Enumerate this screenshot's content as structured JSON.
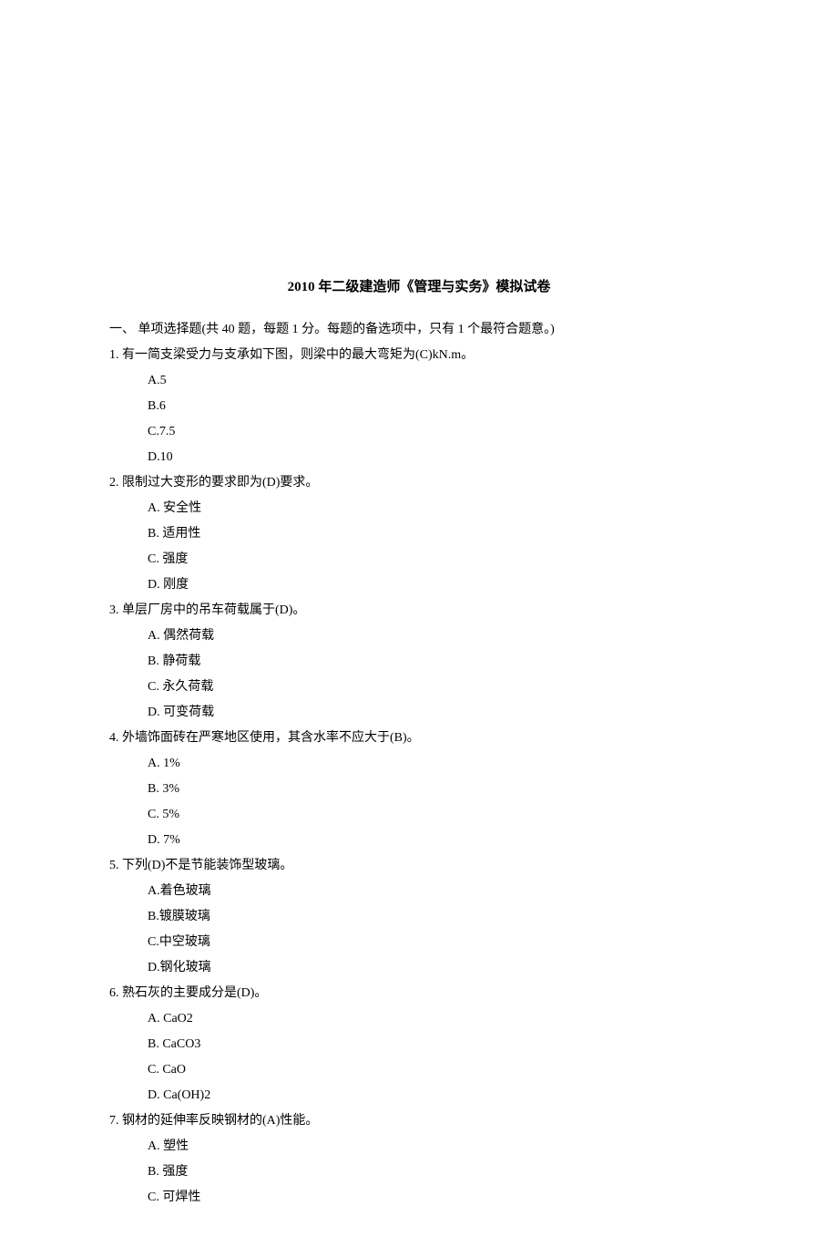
{
  "title": "2010 年二级建造师《管理与实务》模拟试卷",
  "section_header": "一、  单项选择题(共 40 题，每题 1 分。每题的备选项中，只有 1 个最符合题意。)",
  "questions": [
    {
      "number": "1.",
      "text": "有一简支梁受力与支承如下图，则梁中的最大弯矩为(C)kN.m。",
      "options": [
        "A.5",
        "B.6",
        "C.7.5",
        "D.10"
      ]
    },
    {
      "number": "2.",
      "text": "限制过大变形的要求即为(D)要求。",
      "options": [
        "A. 安全性",
        "B. 适用性",
        "C. 强度",
        "D. 刚度"
      ]
    },
    {
      "number": "3.",
      "text": "单层厂房中的吊车荷载属于(D)。",
      "options": [
        "A. 偶然荷载",
        "B. 静荷载",
        "C. 永久荷载",
        "D. 可变荷载"
      ]
    },
    {
      "number": "4.",
      "text": "外墙饰面砖在严寒地区使用，其含水率不应大于(B)。",
      "options": [
        "A. 1%",
        "B. 3%",
        "C. 5%",
        "D. 7%"
      ]
    },
    {
      "number": "5.",
      "text": "下列(D)不是节能装饰型玻璃。",
      "options": [
        "A.着色玻璃",
        "B.镀膜玻璃",
        "C.中空玻璃",
        "D.钢化玻璃"
      ]
    },
    {
      "number": "6.",
      "text": "熟石灰的主要成分是(D)。",
      "options": [
        "A. CaO2",
        "B. CaCO3",
        "C. CaO",
        "D. Ca(OH)2"
      ]
    },
    {
      "number": "7.",
      "text": "钢材的延伸率反映钢材的(A)性能。",
      "options": [
        "A. 塑性",
        "B. 强度",
        "C. 可焊性"
      ]
    }
  ]
}
